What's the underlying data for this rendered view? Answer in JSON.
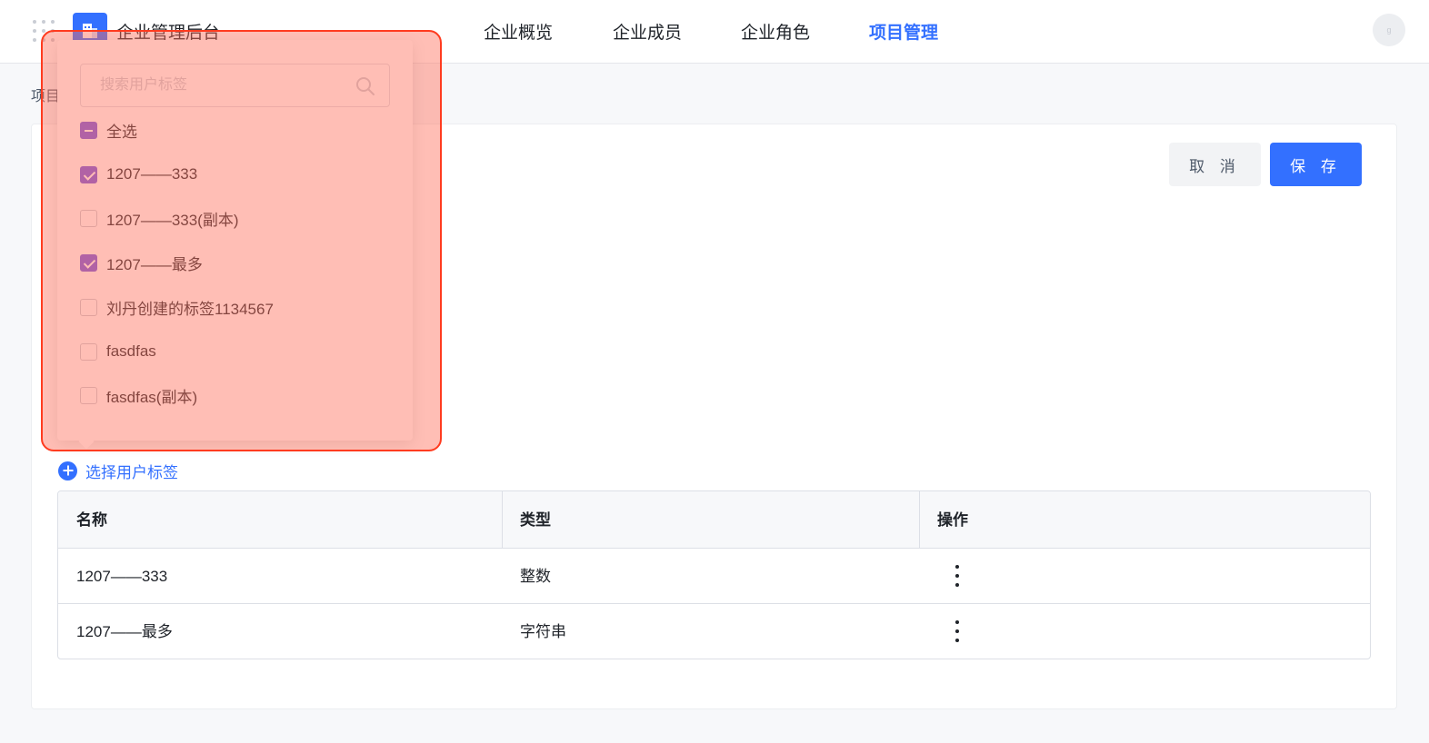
{
  "header": {
    "app_title": "企业管理后台",
    "nav": [
      {
        "label": "企业概览",
        "active": false
      },
      {
        "label": "企业成员",
        "active": false
      },
      {
        "label": "企业角色",
        "active": false
      },
      {
        "label": "项目管理",
        "active": true
      }
    ],
    "avatar_text": "g"
  },
  "breadcrumb": "项目",
  "actions": {
    "cancel_label": "取 消",
    "save_label": "保 存"
  },
  "tag_dropdown": {
    "search_placeholder": "搜索用户标签",
    "select_all": {
      "label": "全选",
      "state": "indeterminate"
    },
    "options": [
      {
        "label": "1207——333",
        "checked": true
      },
      {
        "label": "1207——333(副本)",
        "checked": false
      },
      {
        "label": "1207——最多",
        "checked": true
      },
      {
        "label": "刘丹创建的标签1134567",
        "checked": false
      },
      {
        "label": "fasdfas",
        "checked": false
      },
      {
        "label": "fasdfas(副本)",
        "checked": false
      }
    ]
  },
  "add_tag_label": "选择用户标签",
  "table": {
    "headers": [
      "名称",
      "类型",
      "操作"
    ],
    "rows": [
      {
        "name": "1207——333",
        "type": "整数"
      },
      {
        "name": "1207——最多",
        "type": "字符串"
      }
    ]
  },
  "colors": {
    "accent": "#3370ff",
    "checkbox": "#7158e2",
    "highlight": "#ff3b1f"
  }
}
